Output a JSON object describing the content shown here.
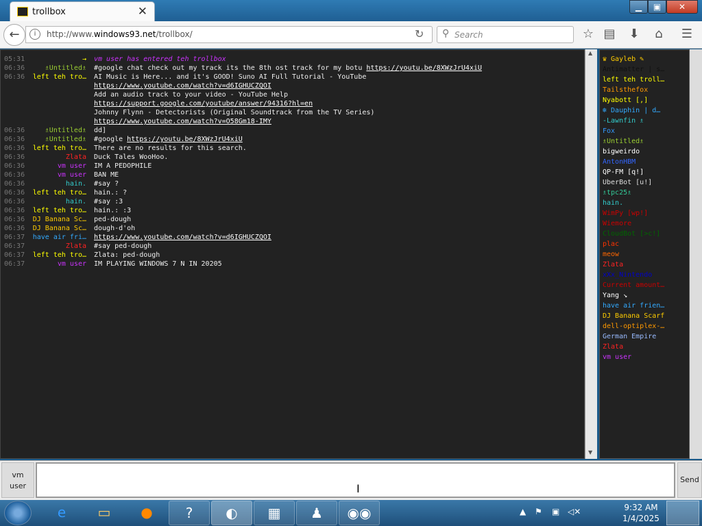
{
  "browser": {
    "tab_title": "trollbox",
    "url_prefix": "http://www.",
    "url_host": "windows93.net",
    "url_path": "/trollbox/",
    "search_placeholder": "Search"
  },
  "chat": [
    {
      "time": "05:31",
      "nick": "→",
      "nick_color": "#ffff00",
      "msg": "",
      "sys": "vm user has entered teh trollbox"
    },
    {
      "time": "06:36",
      "nick": "♗Untitled♗",
      "nick_color": "#9acd32",
      "msg": "#google chat check out my track its the 8th ost track for my botu ",
      "link": "https://youtu.be/8XWzJrU4xiU"
    },
    {
      "time": "06:36",
      "nick": "left teh tro…",
      "nick_color": "#ffff00",
      "msg": "AI Music is Here... and it's GOOD! Suno AI Full Tutorial - YouTube"
    },
    {
      "time": "",
      "nick": "",
      "nick_color": "#fff",
      "msg": "",
      "link": "https://www.youtube.com/watch?v=d6IGHUCZQOI"
    },
    {
      "time": "",
      "nick": "",
      "nick_color": "#fff",
      "msg": "Add an audio track to your video - YouTube Help"
    },
    {
      "time": "",
      "nick": "",
      "nick_color": "#fff",
      "msg": "",
      "link": "https://support.google.com/youtube/answer/94316?hl=en"
    },
    {
      "time": "",
      "nick": "",
      "nick_color": "#fff",
      "msg": "Johnny Flynn - Detectorists (Original Soundtrack from the TV Series)"
    },
    {
      "time": "",
      "nick": "",
      "nick_color": "#fff",
      "msg": "",
      "link": "https://www.youtube.com/watch?v=O58Gm18-IMY"
    },
    {
      "time": "06:36",
      "nick": "♗Untitled♗",
      "nick_color": "#9acd32",
      "msg": "dd]"
    },
    {
      "time": "06:36",
      "nick": "♗Untitled♗",
      "nick_color": "#9acd32",
      "msg": "#google ",
      "link": "https://youtu.be/8XWzJrU4xiU"
    },
    {
      "time": "06:36",
      "nick": "left teh tro…",
      "nick_color": "#ffff00",
      "msg": "There are no results for this search."
    },
    {
      "time": "06:36",
      "nick": "Zlata",
      "nick_color": "#ff2222",
      "msg": "Duck Tales WooHoo."
    },
    {
      "time": "06:36",
      "nick": "vm user",
      "nick_color": "#cc33ff",
      "msg": "IM A PEDOPHILE"
    },
    {
      "time": "06:36",
      "nick": "vm user",
      "nick_color": "#cc33ff",
      "msg": "BAN ME"
    },
    {
      "time": "06:36",
      "nick": "hain.",
      "nick_color": "#33cccc",
      "msg": "#say ?"
    },
    {
      "time": "06:36",
      "nick": "left teh tro…",
      "nick_color": "#ffff00",
      "msg": "hain.: ?"
    },
    {
      "time": "06:36",
      "nick": "hain.",
      "nick_color": "#33cccc",
      "msg": "#say :3"
    },
    {
      "time": "06:36",
      "nick": "left teh tro…",
      "nick_color": "#ffff00",
      "msg": "hain.: :3"
    },
    {
      "time": "06:36",
      "nick": "DJ Banana Sc…",
      "nick_color": "#ffcc00",
      "msg": "ped-dough"
    },
    {
      "time": "06:36",
      "nick": "DJ Banana Sc…",
      "nick_color": "#ffcc00",
      "msg": "dough-d'oh"
    },
    {
      "time": "06:37",
      "nick": "have air fri…",
      "nick_color": "#33aaff",
      "msg": "",
      "link": "https://www.youtube.com/watch?v=d6IGHUCZQOI"
    },
    {
      "time": "06:37",
      "nick": "Zlata",
      "nick_color": "#ff2222",
      "msg": "#say ped-dough"
    },
    {
      "time": "06:37",
      "nick": "left teh tro…",
      "nick_color": "#ffff00",
      "msg": "Zlata: ped-dough"
    },
    {
      "time": "06:37",
      "nick": "vm user",
      "nick_color": "#cc33ff",
      "msg": "IM PLAYING WINDOWS 7 N IN 20205"
    }
  ],
  "users": [
    {
      "name": "♛ Gayleb ✎",
      "color": "#ffcc00"
    },
    {
      "name": "Antimatter | s…",
      "color": "#111111"
    },
    {
      "name": "left teh troll…",
      "color": "#ffff00"
    },
    {
      "name": "Tailsthefox",
      "color": "#ff9900"
    },
    {
      "name": "Nyabott [,]",
      "color": "#ffff00"
    },
    {
      "name": "❄ Dauphin | d…",
      "color": "#33aaff"
    },
    {
      "name": "-Lawnfin ♗",
      "color": "#33cccc"
    },
    {
      "name": "Fox",
      "color": "#3399ff"
    },
    {
      "name": "♗Untitled♗",
      "color": "#9acd32"
    },
    {
      "name": "bigweirdo",
      "color": "#ffffff"
    },
    {
      "name": "AntonHBM",
      "color": "#3366ff"
    },
    {
      "name": "QP-FM [q!]",
      "color": "#ffffff"
    },
    {
      "name": "UberBot [u!]",
      "color": "#dddddd"
    },
    {
      "name": "♗tpc25♗",
      "color": "#33cc99"
    },
    {
      "name": "hain.",
      "color": "#33cccc"
    },
    {
      "name": "WimPy [wp!]",
      "color": "#cc0000"
    },
    {
      "name": "Wiemore",
      "color": "#cc0000"
    },
    {
      "name": "CloudBot [>c!]",
      "color": "#006600"
    },
    {
      "name": "plac",
      "color": "#ff3300"
    },
    {
      "name": "meow",
      "color": "#ff6600"
    },
    {
      "name": "Zlata",
      "color": "#ff2222"
    },
    {
      "name": "xXx_Nintendo",
      "color": "#0000cc"
    },
    {
      "name": "Current amount…",
      "color": "#cc0000"
    },
    {
      "name": "Yang ↘",
      "color": "#ffffff"
    },
    {
      "name": "have air frien…",
      "color": "#33aaff"
    },
    {
      "name": "DJ Banana Scarf",
      "color": "#ffcc00"
    },
    {
      "name": "dell-optiplex-…",
      "color": "#ff9900"
    },
    {
      "name": "German Empire",
      "color": "#99bbff"
    },
    {
      "name": "Zlata",
      "color": "#ff2222"
    },
    {
      "name": "vm user",
      "color": "#cc33ff"
    }
  ],
  "input": {
    "nick_line1": "vm",
    "nick_line2": "user",
    "send_label": "Send",
    "value": ""
  },
  "taskbar": {
    "time": "9:32 AM",
    "date": "1/4/2025"
  }
}
